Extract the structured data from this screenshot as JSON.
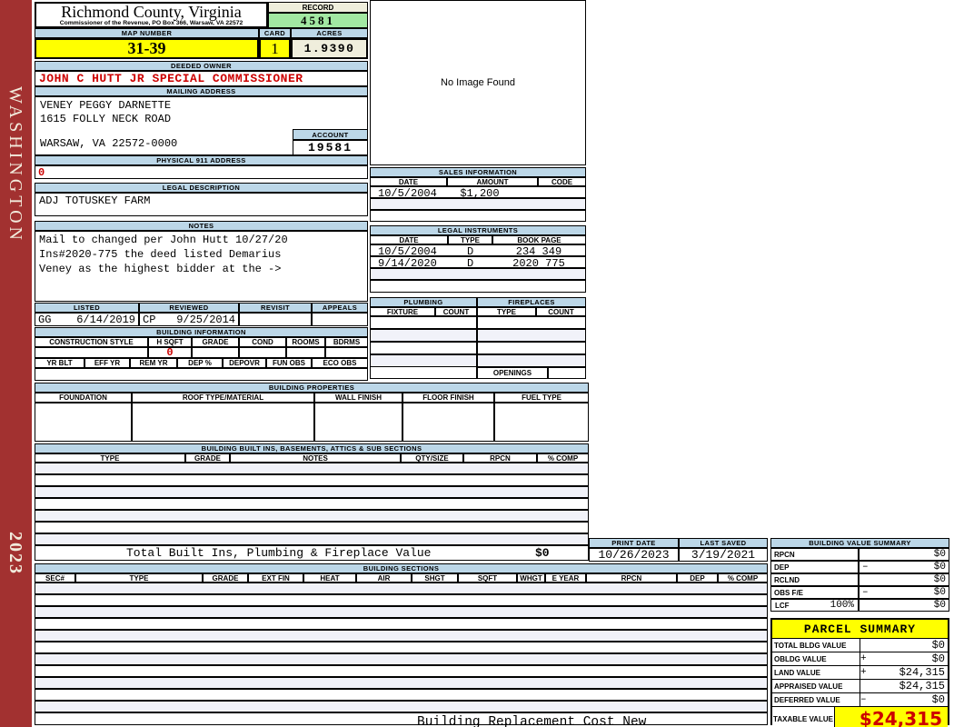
{
  "sidebar": {
    "district": "WASHINGTON",
    "year": "2023"
  },
  "header": {
    "county": "Richmond County, Virginia",
    "subtitle": "Commissioner of the Revenue, PO Box 366, Warsaw, VA 22572",
    "record_label": "RECORD",
    "record": "4581",
    "map_label": "MAP NUMBER",
    "map_number": "31-39",
    "card_label": "CARD",
    "card": "1",
    "acres_label": "ACRES",
    "acres": "1.9390"
  },
  "owner": {
    "label": "DEEDED OWNER",
    "name": "JOHN C HUTT JR SPECIAL COMMISSIONER"
  },
  "mailing": {
    "label": "MAILING ADDRESS",
    "line1": "VENEY PEGGY DARNETTE",
    "line2": "1615 FOLLY NECK ROAD",
    "line3": "WARSAW, VA 22572-0000",
    "account_label": "ACCOUNT",
    "account": "19581"
  },
  "physical": {
    "label": "PHYSICAL 911 ADDRESS",
    "value": "0"
  },
  "legal": {
    "label": "LEGAL DESCRIPTION",
    "value": "ADJ TOTUSKEY FARM"
  },
  "notes": {
    "label": "NOTES",
    "lines": [
      "Mail to changed per John Hutt 10/27/20",
      "Ins#2020-775 the deed listed Demarius",
      "Veney as the highest bidder at the ->"
    ]
  },
  "review": {
    "headers": [
      "LISTED",
      "REVIEWED",
      "REVISIT",
      "APPEALS"
    ],
    "listed_by": "GG",
    "listed_date": "6/14/2019",
    "reviewed_by": "CP",
    "reviewed_date": "9/25/2014"
  },
  "building_info": {
    "title": "BUILDING INFORMATION",
    "headers1": [
      "CONSTRUCTION STYLE",
      "H SQFT",
      "GRADE",
      "COND",
      "ROOMS",
      "BDRMS"
    ],
    "h_sqft": "0",
    "headers2": [
      "YR BLT",
      "EFF YR",
      "REM YR",
      "DEP %",
      "DEPOVR",
      "FUN OBS",
      "ECO OBS"
    ]
  },
  "building_properties": {
    "title": "BUILDING PROPERTIES",
    "headers": [
      "FOUNDATION",
      "ROOF TYPE/MATERIAL",
      "WALL FINISH",
      "FLOOR FINISH",
      "FUEL TYPE"
    ]
  },
  "built_ins": {
    "title": "BUILDING BUILT INS, BASEMENTS, ATTICS & SUB SECTIONS",
    "headers": [
      "TYPE",
      "GRADE",
      "NOTES",
      "QTY/SIZE",
      "RPCN",
      "% COMP"
    ],
    "total_label": "Total Built Ins, Plumbing & Fireplace Value",
    "total_value": "$0"
  },
  "building_sections": {
    "title": "BUILDING SECTIONS",
    "headers": [
      "SEC#",
      "TYPE",
      "GRADE",
      "EXT FIN",
      "HEAT",
      "AIR",
      "SHGT",
      "SQFT",
      "WHGT",
      "E YEAR",
      "RPCN",
      "DEP",
      "% COMP"
    ]
  },
  "image_panel": {
    "text": "No Image Found"
  },
  "sales": {
    "title": "SALES INFORMATION",
    "headers": [
      "DATE",
      "AMOUNT",
      "CODE"
    ],
    "rows": [
      [
        "10/5/2004",
        "$1,200",
        ""
      ]
    ]
  },
  "instruments": {
    "title": "LEGAL INSTRUMENTS",
    "headers": [
      "DATE",
      "TYPE",
      "BOOK PAGE"
    ],
    "rows": [
      [
        "10/5/2004",
        "D",
        "234 349"
      ],
      [
        "9/14/2020",
        "D",
        "2020 775"
      ]
    ]
  },
  "plumbing": {
    "title": "PLUMBING",
    "headers": [
      "FIXTURE",
      "COUNT"
    ]
  },
  "fireplaces": {
    "title": "FIREPLACES",
    "headers": [
      "TYPE",
      "COUNT"
    ],
    "openings_label": "OPENINGS"
  },
  "print_info": {
    "print_date_label": "PRINT DATE",
    "print_date": "10/26/2023",
    "last_saved_label": "LAST SAVED",
    "last_saved": "3/19/2021"
  },
  "building_value_summary": {
    "title": "BUILDING VALUE SUMMARY",
    "rows": [
      {
        "label": "RPCN",
        "sign": "",
        "value": "$0"
      },
      {
        "label": "DEP",
        "sign": "–",
        "value": "$0"
      },
      {
        "label": "RCLND",
        "sign": "",
        "value": "$0"
      },
      {
        "label": "OBS F/E",
        "sign": "–",
        "value": "$0"
      },
      {
        "label": "LCF",
        "pct": "100%",
        "sign": "",
        "value": "$0"
      }
    ]
  },
  "parcel_summary": {
    "title": "PARCEL SUMMARY",
    "rows": [
      {
        "label": "TOTAL BLDG VALUE",
        "sign": "",
        "value": "$0"
      },
      {
        "label": "OBLDG VALUE",
        "sign": "+",
        "value": "$0"
      },
      {
        "label": "LAND VALUE",
        "sign": "+",
        "value": "$24,315"
      },
      {
        "label": "APPRAISED VALUE",
        "sign": "",
        "value": "$24,315"
      },
      {
        "label": "DEFERRED VALUE",
        "sign": "–",
        "value": "$0"
      }
    ],
    "taxable_label": "TAXABLE VALUE",
    "taxable_value": "$24,315"
  },
  "footer": {
    "text": "Building Replacement Cost New"
  },
  "colors": {
    "bar_blue": "#BCD7E8",
    "highlight_yellow": "#FFFF00",
    "record_green": "#A2E8A2",
    "acres_cream": "#EFEEDC",
    "sidebar_red": "#A23130",
    "alert_red": "#CC0000"
  }
}
